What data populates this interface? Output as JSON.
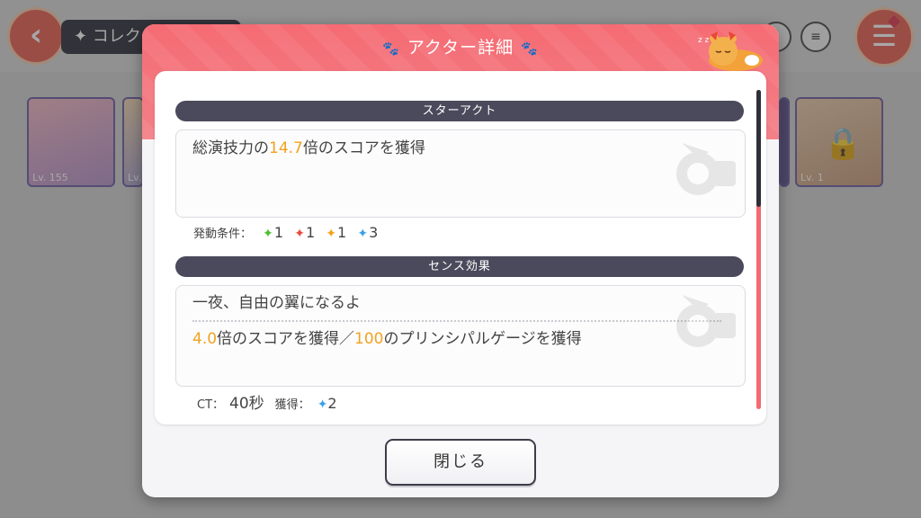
{
  "background": {
    "back_icon": "arrow-left-icon",
    "title": "✦ コレク",
    "menu_icon": "list-icon",
    "cards": [
      {
        "level": "Lv. 155"
      },
      {
        "level": "Lv."
      },
      {
        "level": "Lv. 1",
        "locked": true
      }
    ]
  },
  "modal": {
    "title": "アクター詳細",
    "title_icon": "paw-icon",
    "star_act": {
      "header": "スターアクト",
      "desc_pre": "総演技力の",
      "desc_value": "14.7",
      "desc_post": "倍のスコアを獲得",
      "condition_label": "発動条件：",
      "conditions": [
        {
          "color": "#4bbd2e",
          "count": "1"
        },
        {
          "color": "#e8493a",
          "count": "1"
        },
        {
          "color": "#f2a21e",
          "count": "1"
        },
        {
          "color": "#3aa0e8",
          "count": "3"
        }
      ]
    },
    "sense": {
      "header": "センス効果",
      "name": "一夜、自由の翼になるよ",
      "value1": "4.0",
      "text1": "倍のスコアを獲得／",
      "value2": "100",
      "text2": "のプリンシパルゲージを獲得",
      "ct_label": "CT：",
      "ct_value": "40秒",
      "gain_label": "獲得：",
      "gain_count": "2",
      "gain_color": "#3aa0e8"
    },
    "close_label": "閉じる"
  },
  "colors": {
    "header_accent": "#f56b73",
    "section_bar": "#4b4a5c",
    "highlight": "#f2a21e"
  }
}
